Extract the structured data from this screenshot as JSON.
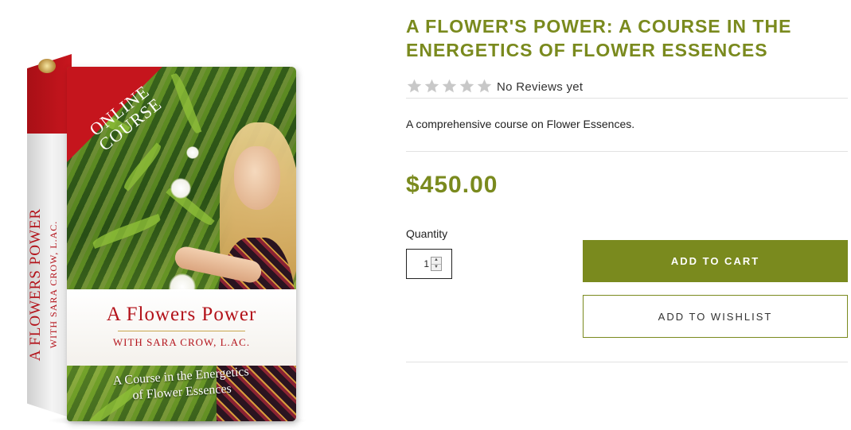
{
  "product": {
    "title": "A FLOWER'S POWER: A COURSE IN THE ENERGETICS OF FLOWER ESSENCES",
    "rating": {
      "stars_filled": 0,
      "stars_total": 5,
      "text": "No Reviews yet"
    },
    "description": "A comprehensive course on Flower Essences.",
    "price": "$450.00",
    "quantity": {
      "label": "Quantity",
      "value": "1"
    },
    "add_to_cart_label": "ADD TO CART",
    "add_to_wishlist_label": "ADD TO WISHLIST"
  },
  "product_image": {
    "ribbon_line1": "ONLINE",
    "ribbon_line2": "COURSE",
    "side_title": "A FLOWERS POWER",
    "side_subtitle": "WITH SARA CROW, L.AC.",
    "front_title": "A Flowers Power",
    "front_subtitle": "WITH SARA CROW, L.AC.",
    "front_tagline_line1": "A Course in the Energetics",
    "front_tagline_line2": "of Flower Essences"
  },
  "colors": {
    "accent": "#7a8a1e",
    "box_red": "#c5151d",
    "star_empty": "#c8c8c8"
  }
}
